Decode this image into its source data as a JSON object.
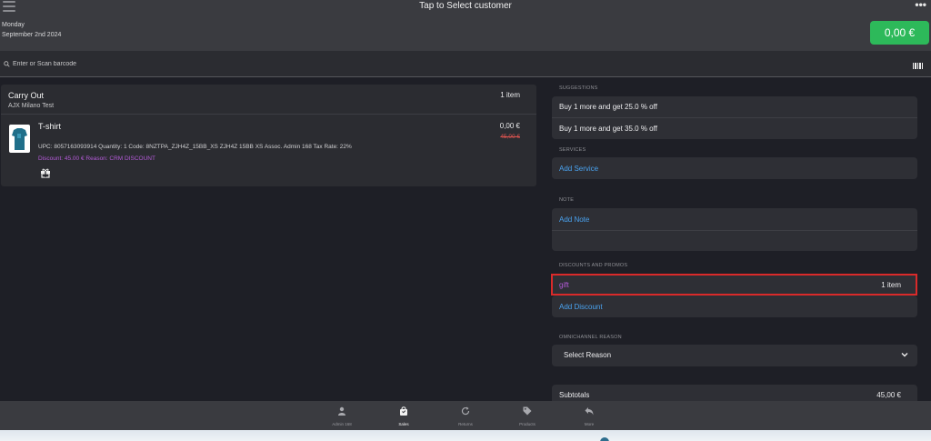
{
  "header": {
    "title": "Tap to Select customer",
    "day": "Monday",
    "date": "September 2nd 2024",
    "total": "0,00 €"
  },
  "search": {
    "placeholder": "Enter or Scan barcode"
  },
  "order": {
    "type": "Carry Out",
    "store": "AJX Milano Test",
    "count": "1 item",
    "product": {
      "name": "T-shirt",
      "details": "UPC: 8057163093914  Quantity: 1  Code: 8NZTPA_ZJH4Z_15BB_XS  ZJH4Z 15BB XS  Assoc. Admin 168  Tax Rate: 22%",
      "discount": "Discount: 45.00 € Reason: CRM DISCOUNT",
      "price": "0,00 €",
      "old_price": "45,00 €"
    }
  },
  "suggestions": {
    "label": "SUGGESTIONS",
    "items": [
      "Buy 1 more and get 25.0 % off",
      "Buy 1 more and get 35.0 % off"
    ]
  },
  "services": {
    "label": "SERVICES",
    "add": "Add Service"
  },
  "note": {
    "label": "NOTE",
    "add": "Add Note"
  },
  "discounts": {
    "label": "DISCOUNTS AND PROMOS",
    "item_name": "gift",
    "item_count": "1 item",
    "add": "Add Discount"
  },
  "omnichannel": {
    "label": "OMNICHANNEL REASON",
    "selected": "Select Reason"
  },
  "subtotals": {
    "label": "Subtotals",
    "value": "45,00 €"
  },
  "tabs": [
    {
      "label": "Admin 168",
      "icon": "person-icon"
    },
    {
      "label": "Sales",
      "icon": "shopping-bag-icon"
    },
    {
      "label": "Returns",
      "icon": "refresh-icon"
    },
    {
      "label": "Products",
      "icon": "tags-icon"
    },
    {
      "label": "More",
      "icon": "reply-icon"
    }
  ],
  "colors": {
    "accent_green": "#2db95a",
    "link_blue": "#4aa3f0",
    "discount_purple": "#b45ad8",
    "highlight_red": "#d92a2a"
  }
}
